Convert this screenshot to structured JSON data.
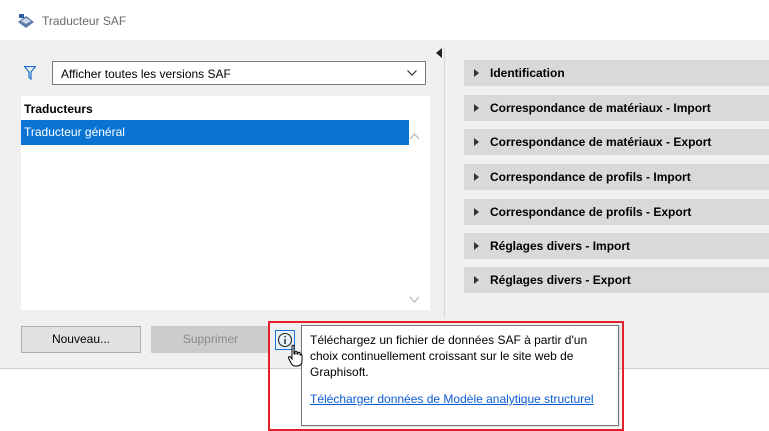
{
  "window": {
    "title": "Traducteur SAF"
  },
  "filter": {
    "selected": "Afficher toutes les versions SAF"
  },
  "translators": {
    "header": "Traducteurs",
    "items": [
      "Traducteur général"
    ]
  },
  "sections": [
    "Identification",
    "Correspondance de matériaux - Import",
    "Correspondance de matériaux - Export",
    "Correspondance de profils - Import",
    "Correspondance de profils - Export",
    "Réglages divers - Import",
    "Réglages divers - Export"
  ],
  "buttons": {
    "new": "Nouveau...",
    "delete": "Supprimer"
  },
  "tooltip": {
    "text": "Téléchargez un fichier de données SAF à partir d'un choix continuellement croissant sur le site web de Graphisoft.",
    "link": "Télécharger données de Modèle analytique structurel"
  },
  "colors": {
    "selection": "#0a74d4",
    "highlight_frame": "#e0202a",
    "link": "#0b5bd6"
  },
  "icons": [
    "app-icon",
    "filter-icon",
    "chevron-down-icon",
    "caret-right-icon",
    "info-icon",
    "cursor-icon"
  ]
}
